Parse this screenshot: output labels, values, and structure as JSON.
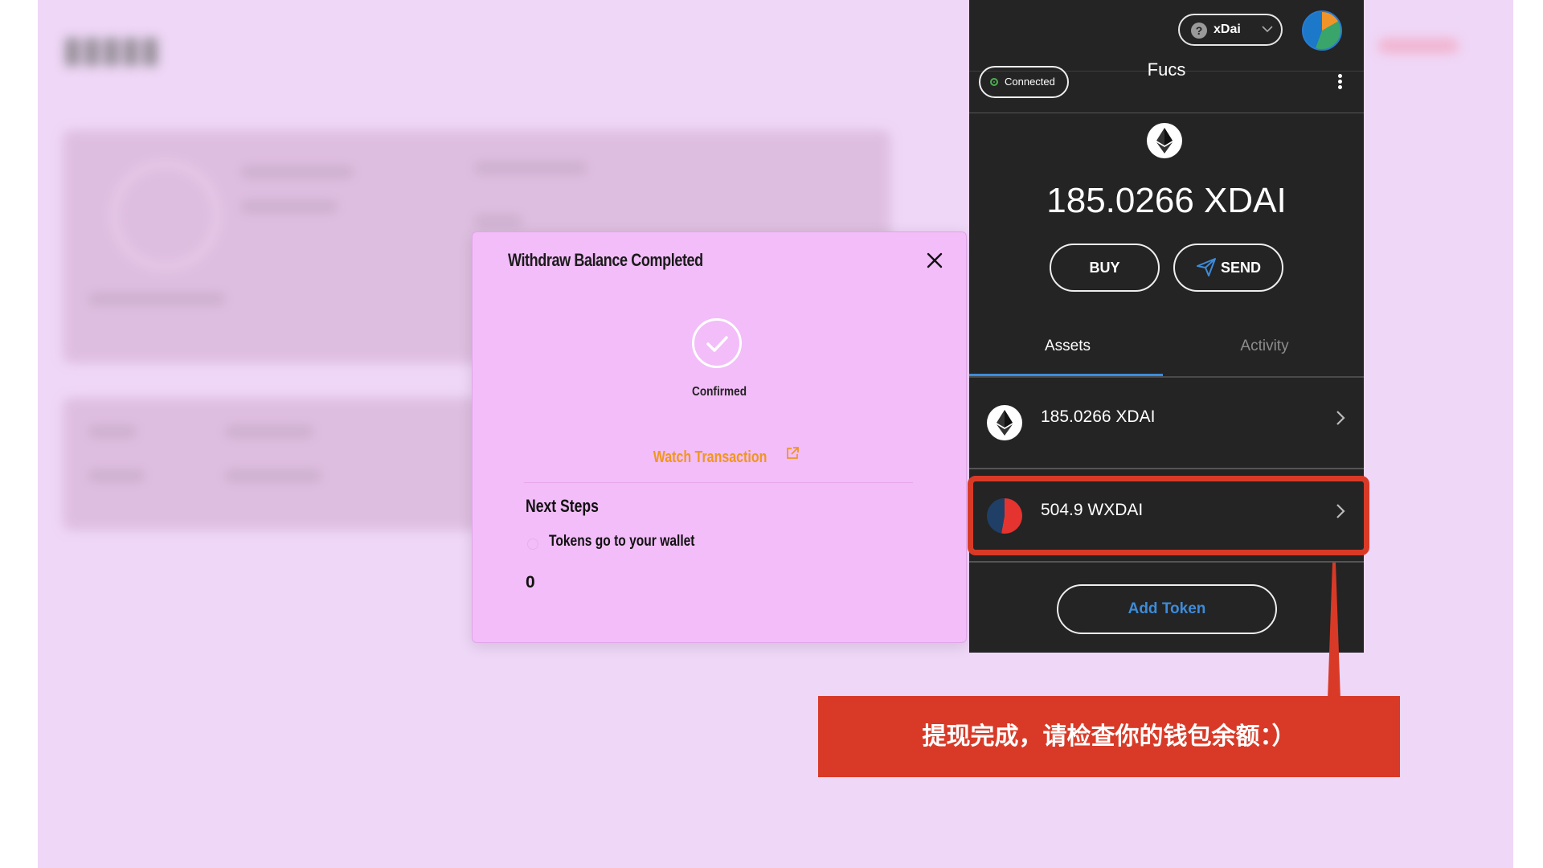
{
  "background": {
    "blurred": true
  },
  "modal": {
    "title": "Withdraw Balance Completed",
    "status": "Confirmed",
    "watch_link": "Watch Transaction",
    "next_steps_heading": "Next Steps",
    "step_text": "Tokens go to your wallet",
    "step_value": "0",
    "colors": {
      "bg": "#f2bdf8",
      "link": "#f0961e"
    }
  },
  "wallet": {
    "network": "xDai",
    "connection_status": "Connected",
    "account_name": "Fucs",
    "balance": "185.0266 XDAI",
    "buy_label": "BUY",
    "send_label": "SEND",
    "tabs": [
      {
        "label": "Assets",
        "active": true
      },
      {
        "label": "Activity",
        "active": false
      }
    ],
    "assets": [
      {
        "label": "185.0266 XDAI",
        "icon": "ethereum-icon"
      },
      {
        "label": "504.9 WXDAI",
        "icon": "wxdai-token-icon"
      }
    ],
    "add_token_label": "Add Token",
    "colors": {
      "bg": "#242424",
      "accent": "#3d8bd9"
    }
  },
  "annotation": {
    "callout_text": "提现完成，请检查你的钱包余额：）",
    "color": "#d83a27"
  }
}
